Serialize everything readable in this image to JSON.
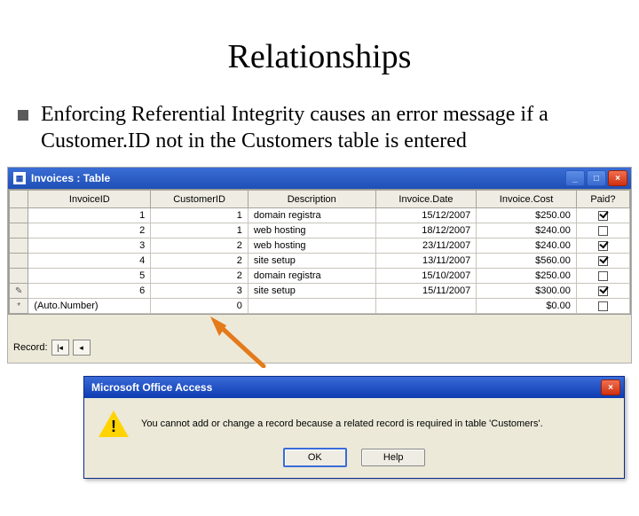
{
  "slide": {
    "title": "Relationships",
    "bullet": "Enforcing Referential Integrity causes an error message if a Customer.ID not in the Customers table is entered"
  },
  "invoices_window": {
    "title": "Invoices : Table",
    "nav_label": "Record:",
    "columns": [
      "InvoiceID",
      "CustomerID",
      "Description",
      "Invoice.Date",
      "Invoice.Cost",
      "Paid?"
    ],
    "rows": [
      {
        "sel": "",
        "InvoiceID": "1",
        "CustomerID": "1",
        "Description": "domain registra",
        "InvoiceDate": "15/12/2007",
        "InvoiceCost": "$250.00",
        "Paid": true
      },
      {
        "sel": "",
        "InvoiceID": "2",
        "CustomerID": "1",
        "Description": "web hosting",
        "InvoiceDate": "18/12/2007",
        "InvoiceCost": "$240.00",
        "Paid": false
      },
      {
        "sel": "",
        "InvoiceID": "3",
        "CustomerID": "2",
        "Description": "web hosting",
        "InvoiceDate": "23/11/2007",
        "InvoiceCost": "$240.00",
        "Paid": true
      },
      {
        "sel": "",
        "InvoiceID": "4",
        "CustomerID": "2",
        "Description": "site setup",
        "InvoiceDate": "13/11/2007",
        "InvoiceCost": "$560.00",
        "Paid": true
      },
      {
        "sel": "",
        "InvoiceID": "5",
        "CustomerID": "2",
        "Description": "domain registra",
        "InvoiceDate": "15/10/2007",
        "InvoiceCost": "$250.00",
        "Paid": false
      },
      {
        "sel": "✎",
        "InvoiceID": "6",
        "CustomerID": "3",
        "Description": "site setup",
        "InvoiceDate": "15/11/2007",
        "InvoiceCost": "$300.00",
        "Paid": true
      },
      {
        "sel": "*",
        "InvoiceID": "(Auto.Number)",
        "CustomerID": "0",
        "Description": "",
        "InvoiceDate": "",
        "InvoiceCost": "$0.00",
        "Paid": false
      }
    ]
  },
  "error_dialog": {
    "title": "Microsoft Office Access",
    "message": "You cannot add or change a record because a related record is required in table 'Customers'.",
    "ok": "OK",
    "help": "Help"
  },
  "icons": {
    "minimize": "_",
    "restore": "□",
    "close": "×"
  }
}
